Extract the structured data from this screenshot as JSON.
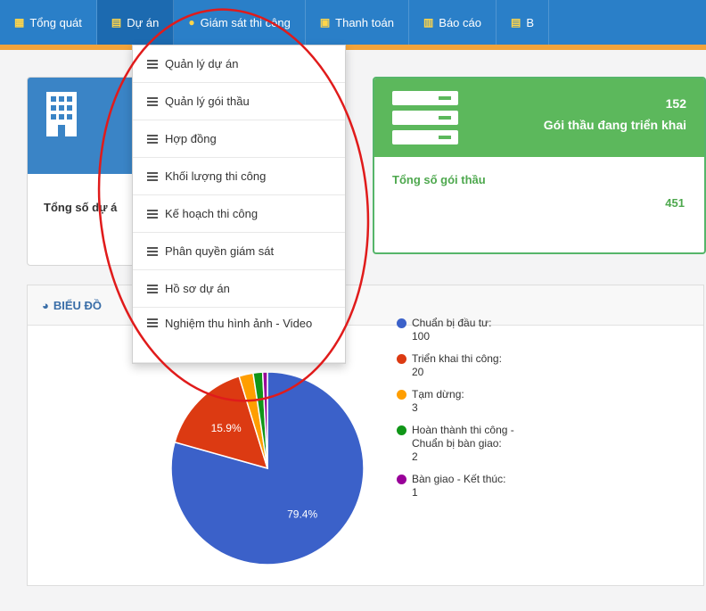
{
  "nav": {
    "items": [
      {
        "icon": "grid-icon",
        "label": "Tổng quát"
      },
      {
        "icon": "clipboard-icon",
        "label": "Dự án"
      },
      {
        "icon": "user-icon",
        "label": "Giám sát thi công"
      },
      {
        "icon": "money-icon",
        "label": "Thanh toán"
      },
      {
        "icon": "bar-chart-icon",
        "label": "Báo cáo"
      },
      {
        "icon": "clipboard-icon",
        "label": "B"
      }
    ],
    "active_index": 1,
    "accent_color": "#f2a33a",
    "bar_color": "#2a7fc8"
  },
  "dropdown": {
    "items": [
      "Quản lý dự án",
      "Quản lý gói thầu",
      "Hợp đồng",
      "Khối lượng thi công",
      "Kế hoạch thi công",
      "Phân quyền giám sát",
      "Hồ sơ dự án",
      "Nghiệm thu hình ảnh - Video"
    ]
  },
  "card_project": {
    "label": "Tổng số dự á",
    "color": "#3a84c6"
  },
  "card_package": {
    "count": "152",
    "subtitle": "Gói thầu đang triển khai",
    "label": "Tổng số gói thầu",
    "value": "451",
    "color": "#5cb85c"
  },
  "chart_panel": {
    "title": "BIỂU ĐỒ"
  },
  "chart_data": {
    "type": "pie",
    "slices": [
      {
        "label": "Chuẩn bị đầu tư:",
        "value": 100,
        "percent_label": "79.4%",
        "color": "#3b61c9"
      },
      {
        "label": "Triển khai thi công:",
        "value": 20,
        "percent_label": "15.9%",
        "color": "#dc3a12"
      },
      {
        "label": "Tạm dừng:",
        "value": 3,
        "percent_label": "",
        "color": "#ff9e00"
      },
      {
        "label": "Hoàn thành thi công - Chuẩn bị bàn giao:",
        "value": 2,
        "percent_label": "",
        "color": "#109618"
      },
      {
        "label": "Bàn giao - Kết thúc:",
        "value": 1,
        "percent_label": "",
        "color": "#990099"
      }
    ],
    "legend_placement": "right"
  },
  "annotation": {
    "color": "#e01b1b"
  }
}
